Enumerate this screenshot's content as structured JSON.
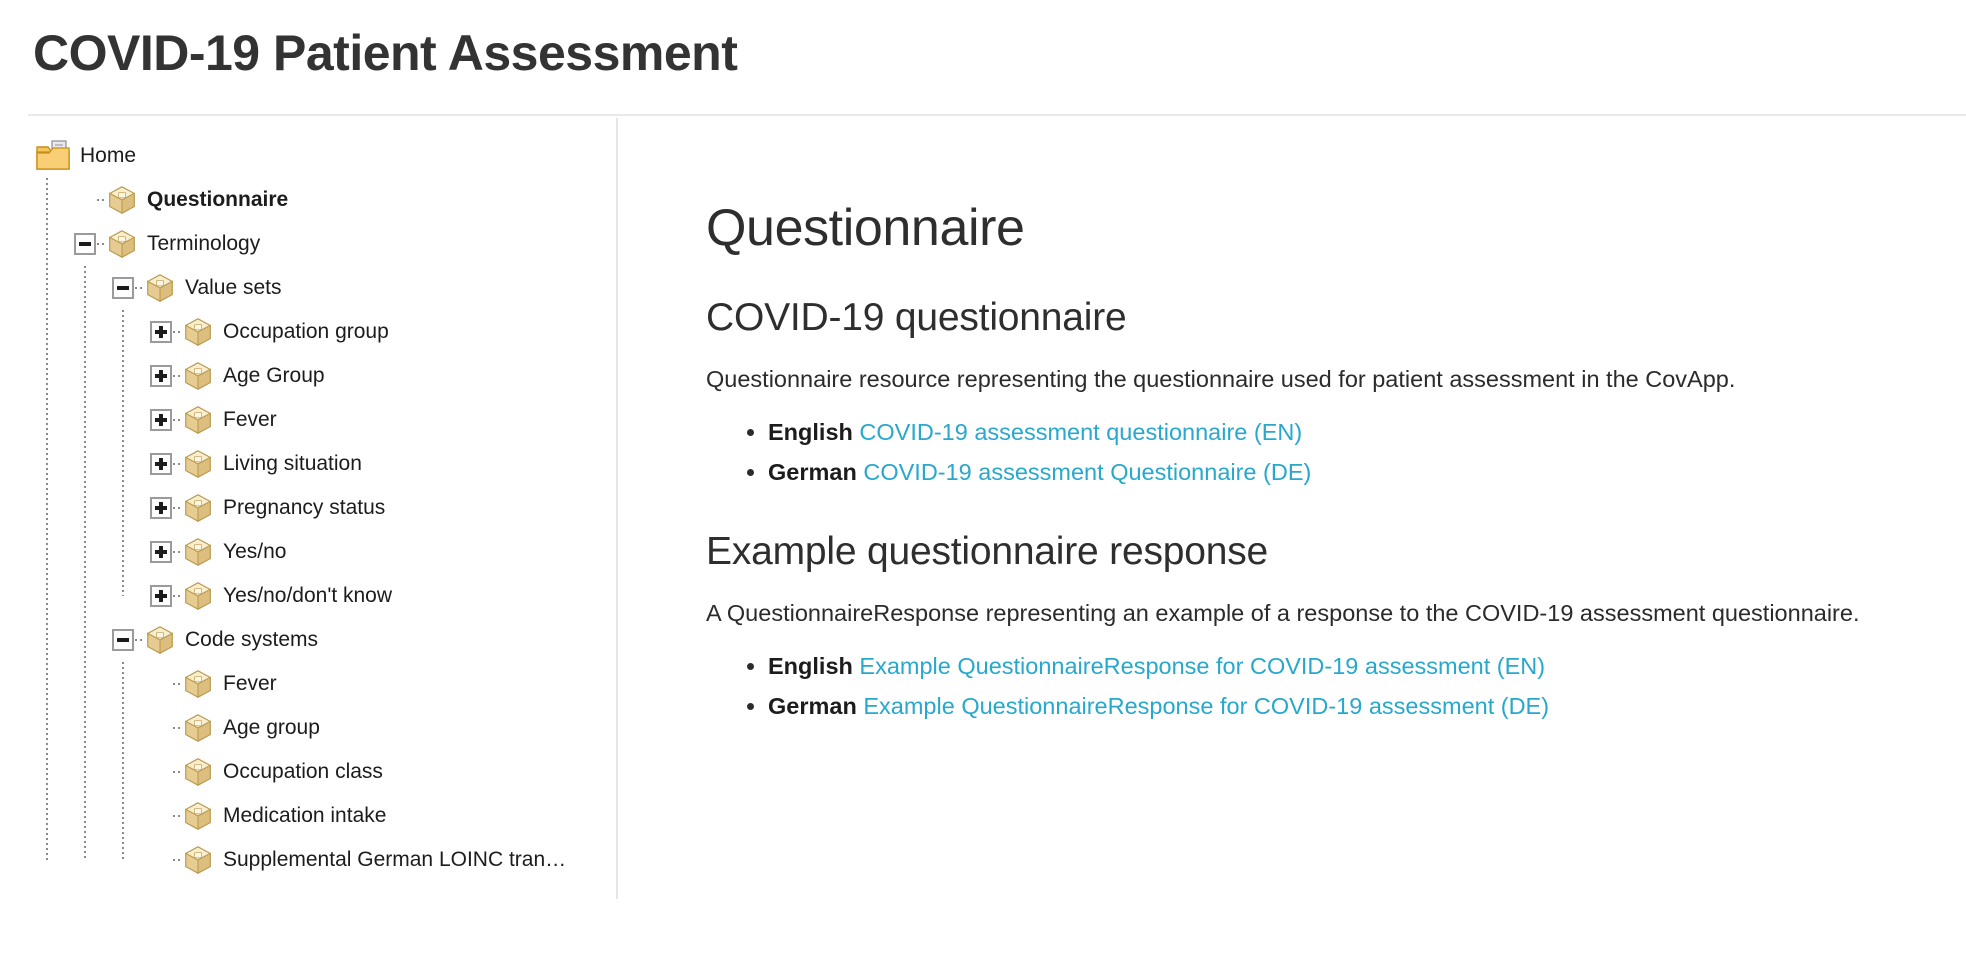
{
  "header": {
    "title": "COVID-19 Patient Assessment"
  },
  "colors": {
    "link": "#27a8cc",
    "title": "#333333",
    "divider": "#e6e6e6",
    "icon_gold": "#e8c77a"
  },
  "sidebar": {
    "items": [
      {
        "label": "Home",
        "icon": "folder-icon",
        "depth": 0,
        "expander": "none",
        "selected": false
      },
      {
        "label": "Questionnaire",
        "icon": "package-icon",
        "depth": 1,
        "expander": "leaf",
        "selected": true
      },
      {
        "label": "Terminology",
        "icon": "package-icon",
        "depth": 1,
        "expander": "minus",
        "selected": false
      },
      {
        "label": "Value sets",
        "icon": "package-icon",
        "depth": 2,
        "expander": "minus",
        "selected": false
      },
      {
        "label": "Occupation group",
        "icon": "package-icon",
        "depth": 3,
        "expander": "plus",
        "selected": false
      },
      {
        "label": "Age Group",
        "icon": "package-icon",
        "depth": 3,
        "expander": "plus",
        "selected": false
      },
      {
        "label": "Fever",
        "icon": "package-icon",
        "depth": 3,
        "expander": "plus",
        "selected": false
      },
      {
        "label": "Living situation",
        "icon": "package-icon",
        "depth": 3,
        "expander": "plus",
        "selected": false
      },
      {
        "label": "Pregnancy status",
        "icon": "package-icon",
        "depth": 3,
        "expander": "plus",
        "selected": false
      },
      {
        "label": "Yes/no",
        "icon": "package-icon",
        "depth": 3,
        "expander": "plus",
        "selected": false
      },
      {
        "label": "Yes/no/don't know",
        "icon": "package-icon",
        "depth": 3,
        "expander": "plus",
        "selected": false
      },
      {
        "label": "Code systems",
        "icon": "package-icon",
        "depth": 2,
        "expander": "minus",
        "selected": false
      },
      {
        "label": "Fever",
        "icon": "package-icon",
        "depth": 3,
        "expander": "leaf",
        "selected": false
      },
      {
        "label": "Age group",
        "icon": "package-icon",
        "depth": 3,
        "expander": "leaf",
        "selected": false
      },
      {
        "label": "Occupation class",
        "icon": "package-icon",
        "depth": 3,
        "expander": "leaf",
        "selected": false
      },
      {
        "label": "Medication intake",
        "icon": "package-icon",
        "depth": 3,
        "expander": "leaf",
        "selected": false
      },
      {
        "label": "Supplemental German LOINC tran…",
        "icon": "package-icon",
        "depth": 3,
        "expander": "leaf",
        "selected": false
      }
    ]
  },
  "main": {
    "heading": "Questionnaire",
    "sections": [
      {
        "heading": "COVID-19 questionnaire",
        "paragraph": "Questionnaire resource representing the questionnaire used for patient assessment in the CovApp.",
        "links": [
          {
            "lang": "English",
            "text": "COVID-19 assessment questionnaire (EN)"
          },
          {
            "lang": "German",
            "text": "COVID-19 assessment Questionnaire (DE)"
          }
        ]
      },
      {
        "heading": "Example questionnaire response",
        "paragraph": "A QuestionnaireResponse representing an example of a response to the COVID-19 assessment questionnaire.",
        "links": [
          {
            "lang": "English",
            "text": "Example QuestionnaireResponse for COVID-19 assessment (EN)"
          },
          {
            "lang": "German",
            "text": "Example QuestionnaireResponse for COVID-19 assessment (DE)"
          }
        ]
      }
    ]
  }
}
